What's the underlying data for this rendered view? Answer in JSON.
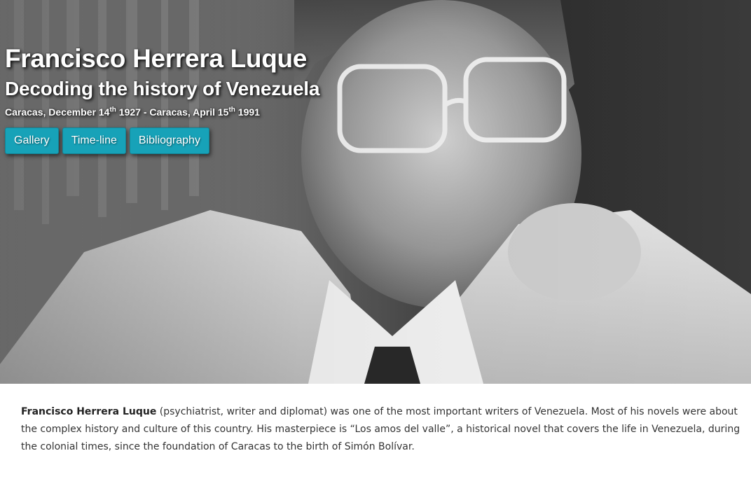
{
  "hero": {
    "title": "Francisco Herrera Luque",
    "subtitle": "Decoding the history of Venezuela",
    "dates": {
      "birth_prefix": "Caracas, December 14",
      "birth_suffix": "th",
      "birth_year_and_separator": " 1927 - Caracas, April 15",
      "death_suffix": "th",
      "death_year": " 1991"
    },
    "photo_description_icon": "portrait-photo"
  },
  "nav": {
    "buttons": [
      {
        "label": "Gallery"
      },
      {
        "label": "Time-line"
      },
      {
        "label": "Bibliography"
      }
    ]
  },
  "intro": {
    "name": "Francisco Herrera Luque",
    "text": " (psychiatrist, writer and diplomat) was one of the most important writers of Venezuela. Most of his novels were about the complex history and culture of this country. His masterpiece is “Los amos del valle”, a historical novel that covers the life in Venezuela, during the colonial times, since the foundation of Caracas to the birth of Simón Bolívar."
  },
  "colors": {
    "button_bg": "#17a2b8",
    "button_text": "#ffffff",
    "body_text": "#333333"
  }
}
